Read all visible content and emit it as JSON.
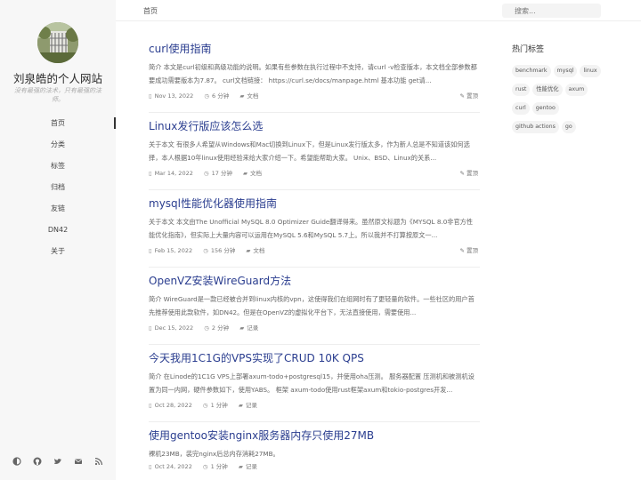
{
  "site": {
    "title": "刘泉皓的个人网站",
    "subtitle": "没有最强的法术，只有最强的法师。"
  },
  "nav": [
    {
      "label": "首页",
      "active": true
    },
    {
      "label": "分类"
    },
    {
      "label": "标签"
    },
    {
      "label": "归档"
    },
    {
      "label": "友链"
    },
    {
      "label": "DN42"
    },
    {
      "label": "关于"
    }
  ],
  "social_icons": [
    "theme-toggle-icon",
    "github-icon",
    "twitter-icon",
    "email-icon",
    "rss-icon"
  ],
  "topbar": {
    "breadcrumb": "首页",
    "search_placeholder": "搜索..."
  },
  "posts": [
    {
      "title": "curl使用指南",
      "excerpt": "简介 本文是curl初级和高级功能的说明。如果有些参数在执行过程中不支持，请curl -v检查版本，本文档全部参数都要成功需要版本为7.87。 curl文档链接： https://curl.se/docs/manpage.html 基本功能 get请...",
      "date": "Nov 13, 2022",
      "read": "6 分钟",
      "category": "文档",
      "pinned": "置顶"
    },
    {
      "title": "Linux发行版应该怎么选",
      "excerpt": "关于本文 有很多人希望从Windows和Mac切换到Linux下，但是Linux发行版太多，作为新人总是不知道该如何选择，本人根据10年linux使用经验来给大家介绍一下。希望能帮助大家。 Unix、BSD、Linux的关系...",
      "date": "Mar 14, 2022",
      "read": "17 分钟",
      "category": "文档",
      "pinned": "置顶"
    },
    {
      "title": "mysql性能优化器使用指南",
      "excerpt": "关于本文 本文由The Unofficial MySQL 8.0 Optimizer Guide翻译得来。虽然原文标题为《MYSQL 8.0非官方性能优化指南》，但实际上大量内容可以运用在MySQL 5.6和MySQL 5.7上。所以我并不打算按原文一...",
      "date": "Feb 15, 2022",
      "read": "156 分钟",
      "category": "文档",
      "pinned": "置顶"
    },
    {
      "title": "OpenVZ安装WireGuard方法",
      "excerpt": "简介 WireGuard是一款已经被合并到linux内核的vpn，这使得我们在组网时有了更轻量的软件。一些社区的用户首先推荐使用此款软件，如DN42。但是在OpenVZ的虚拟化平台下，无法直接使用，需要使用...",
      "date": "Dec 15, 2022",
      "read": "2 分钟",
      "category": "记录",
      "pinned": ""
    },
    {
      "title": "今天我用1C1G的VPS实现了CRUD 10K QPS",
      "excerpt": "简介 在Linode的1C1G VPS上部署axum-todo+postgresql15，并使用oha压测。 服务器配置 压测机和被测机设置为同一内网，硬件参数如下，使用YABS。 框架 axum-todo使用rust框架axum和tokio-postgres开发...",
      "date": "Oct 28, 2022",
      "read": "1 分钟",
      "category": "记录",
      "pinned": ""
    },
    {
      "title": "使用gentoo安装nginx服务器内存只使用27MB",
      "excerpt": "裸机23MB，装完nginx后总内存消耗27MB。",
      "date": "Oct 24, 2022",
      "read": "1 分钟",
      "category": "记录",
      "pinned": ""
    }
  ],
  "tags_section": {
    "title": "热门标签",
    "tags": [
      "benchmark",
      "mysql",
      "linux",
      "rust",
      "性能优化",
      "axum",
      "curl",
      "gentoo",
      "github actions",
      "go"
    ]
  }
}
